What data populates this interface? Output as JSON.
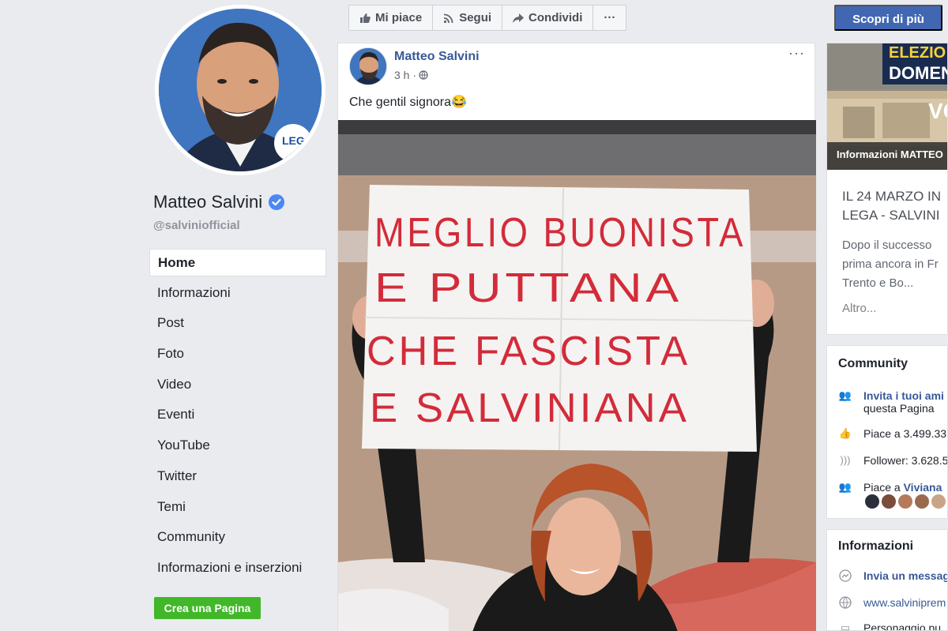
{
  "profile": {
    "name": "Matteo Salvini",
    "handle": "@salviniofficial"
  },
  "nav": {
    "items": [
      {
        "label": "Home",
        "active": true
      },
      {
        "label": "Informazioni"
      },
      {
        "label": "Post"
      },
      {
        "label": "Foto"
      },
      {
        "label": "Video"
      },
      {
        "label": "Eventi"
      },
      {
        "label": "YouTube"
      },
      {
        "label": "Twitter"
      },
      {
        "label": "Temi"
      },
      {
        "label": "Community"
      },
      {
        "label": "Informazioni e inserzioni"
      }
    ],
    "create_page": "Crea una Pagina"
  },
  "actions": {
    "like": "Mi piace",
    "follow": "Segui",
    "share": "Condividi",
    "more": "···",
    "discover": "Scopri di più"
  },
  "post": {
    "author": "Matteo Salvini",
    "time": "3 h ·",
    "more": "···",
    "text": "Che gentil signora",
    "emoji": "😂",
    "sign_lines": [
      "MEGLIO BUONISTA",
      "E PUTTANA",
      "CHE FASCISTA",
      "E SALVINIANA"
    ]
  },
  "ad": {
    "banner_top": "ELEZIO",
    "banner_mid": "DOMEN",
    "banner_v": "VC",
    "caption": "Informazioni MATTEO",
    "title_1": "IL 24 MARZO IN",
    "title_2": "LEGA - SALVINI",
    "desc_1": "Dopo il successo",
    "desc_2": "prima ancora in Fr",
    "desc_3": "Trento e Bo...",
    "more": "Altro..."
  },
  "community": {
    "title": "Community",
    "invite_link": "Invita i tuoi ami",
    "invite_rest": "questa Pagina",
    "likes": "Piace a 3.499.33",
    "followers": "Follower: 3.628.5",
    "liked_by_prefix": "Piace a ",
    "liked_by_name": "Viviana"
  },
  "info": {
    "title": "Informazioni",
    "message": "Invia un messag",
    "website": "www.salviniprem",
    "category": "Personaggio pu"
  },
  "colors": {
    "fb_blue": "#4267b2",
    "link_blue": "#385898",
    "green": "#42b72a",
    "bg": "#e9ebee"
  }
}
